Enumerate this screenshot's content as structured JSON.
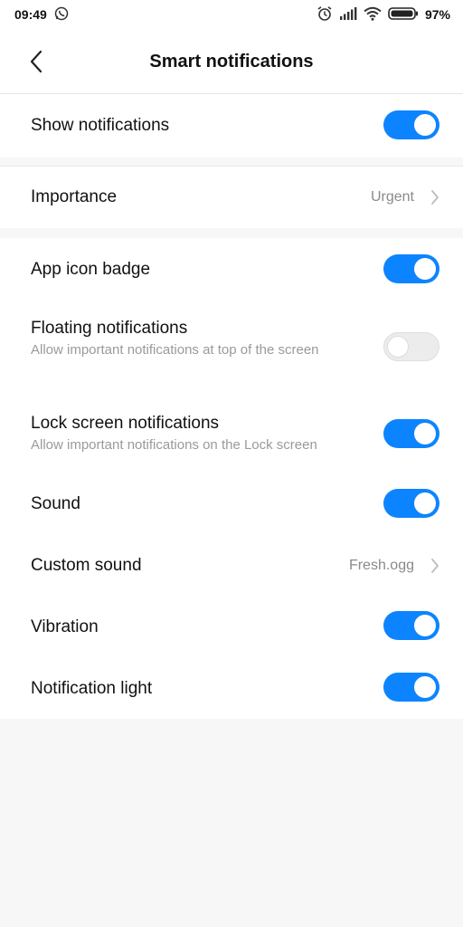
{
  "status_bar": {
    "time": "09:49",
    "battery": "97%",
    "icons": [
      "whatsapp-icon",
      "alarm-icon",
      "signal-icon",
      "wifi-icon",
      "battery-icon"
    ]
  },
  "header": {
    "title": "Smart notifications"
  },
  "rows": {
    "show_notifications": {
      "label": "Show notifications",
      "enabled": true
    },
    "importance": {
      "label": "Importance",
      "value": "Urgent"
    },
    "app_icon_badge": {
      "label": "App icon badge",
      "enabled": true
    },
    "floating_notifications": {
      "label": "Floating notifications",
      "description": "Allow important notifications at top of the screen",
      "enabled": false
    },
    "lock_screen_notifications": {
      "label": "Lock screen notifications",
      "description": "Allow important notifications on the Lock screen",
      "enabled": true
    },
    "sound": {
      "label": "Sound",
      "enabled": true
    },
    "custom_sound": {
      "label": "Custom sound",
      "value": "Fresh.ogg"
    },
    "vibration": {
      "label": "Vibration",
      "enabled": true
    },
    "notification_light": {
      "label": "Notification light",
      "enabled": true
    }
  },
  "colors": {
    "accent": "#0d84ff",
    "background": "#f7f7f7",
    "surface": "#ffffff",
    "secondary_text": "#9a9a9a"
  }
}
